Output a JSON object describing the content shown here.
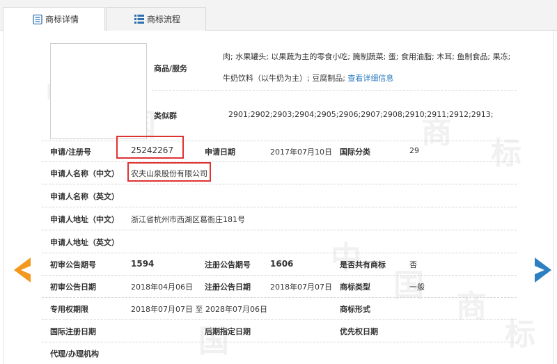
{
  "tabs": [
    {
      "label": "商标详情",
      "icon": "document-icon",
      "active": true
    },
    {
      "label": "商标流程",
      "icon": "list-icon",
      "active": false
    }
  ],
  "goods": {
    "label": "商品/服务",
    "line1": "肉; 水果罐头; 以果蔬为主的零食小吃; 腌制蔬菜; 蛋; 食用油脂; 木耳; 鱼制食品; 果冻;",
    "line2": "牛奶饮料（以牛奶为主）; 豆腐制品;",
    "link": "查看详细信息"
  },
  "similar_group": {
    "label": "类似群",
    "value": "2901;2902;2903;2904;2905;2906;2907;2908;2910;2911;2912;2913;"
  },
  "fields": {
    "reg_no_label": "申请/注册号",
    "reg_no": "25242267",
    "apply_date_label": "申请日期",
    "apply_date": "2017年07月10日",
    "intl_class_label": "国际分类",
    "intl_class": "29",
    "applicant_cn_label": "申请人名称（中文）",
    "applicant_cn": "农夫山泉股份有限公司",
    "applicant_en_label": "申请人名称（英文）",
    "address_cn_label": "申请人地址（中文）",
    "address_cn": "浙江省杭州市西湖区葛衙庄181号",
    "address_en_label": "申请人地址（英文）",
    "prelim_no_label": "初审公告期号",
    "prelim_no": "1594",
    "reg_pub_no_label": "注册公告期号",
    "reg_pub_no": "1606",
    "shared_label": "是否共有商标",
    "shared": "否",
    "prelim_date_label": "初审公告日期",
    "prelim_date": "2018年04月06日",
    "reg_pub_date_label": "注册公告日期",
    "reg_pub_date": "2018年07月07日",
    "tm_type_label": "商标类型",
    "tm_type": "一般",
    "exclusive_label": "专用权期限",
    "exclusive": "2018年07月07日 至 2028年07月06日",
    "tm_form_label": "商标形式",
    "intl_reg_date_label": "国际注册日期",
    "later_date_label": "后期指定日期",
    "priority_date_label": "优先权日期",
    "agent_label": "代理/办理机构"
  },
  "watermark": {
    "zhong": "中",
    "guo": "国",
    "shang": "商",
    "biao": "标"
  },
  "colors": {
    "arrow": "#f39a1e",
    "arrow_right": "#2e7fc1",
    "highlight": "#e03232",
    "link": "#2b7bc0"
  }
}
